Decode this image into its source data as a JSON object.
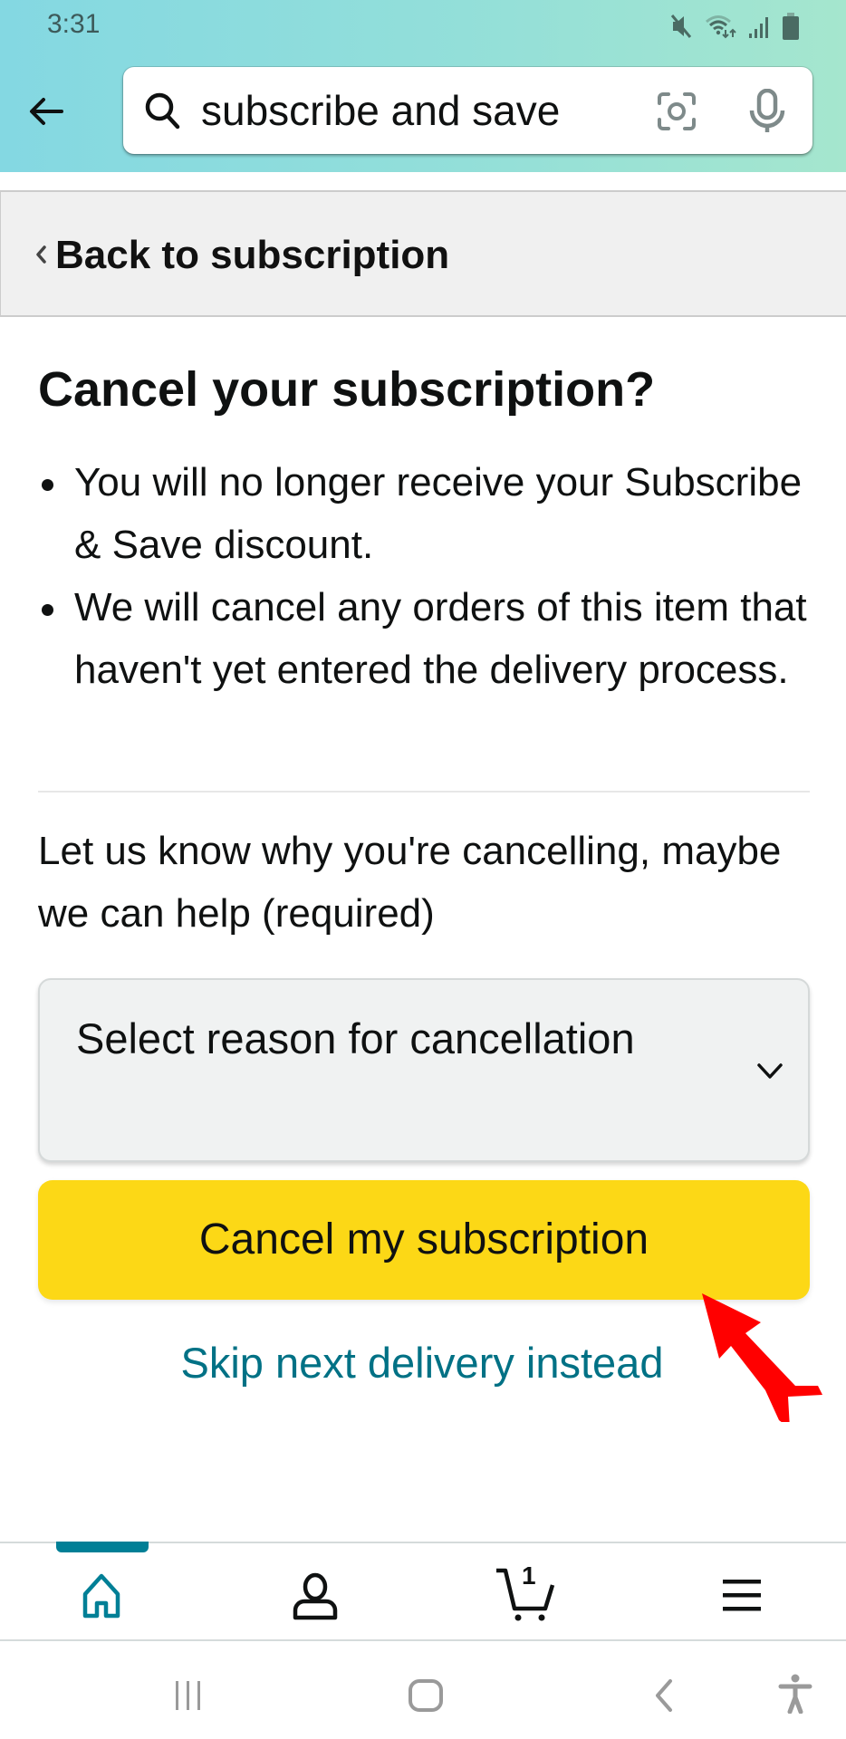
{
  "status_bar": {
    "time": "3:31",
    "icons": [
      "mute-icon",
      "wifi-icon",
      "signal-icon",
      "battery-icon"
    ]
  },
  "header": {
    "back_icon": "arrow-left-icon",
    "search": {
      "value": "subscribe and save",
      "icons": [
        "search-icon",
        "camera-lens-icon",
        "microphone-icon"
      ]
    },
    "colors": {
      "gradient_start": "#84D8E2",
      "gradient_end": "#A5E6CE"
    }
  },
  "back_bar": {
    "label": "Back to subscription",
    "icon": "chevron-left-icon"
  },
  "main": {
    "title": "Cancel your subscription?",
    "bullets": [
      "You will no longer receive your Subscribe & Save discount.",
      "We will cancel any orders of this item that haven't yet entered the delivery process."
    ],
    "reason_prompt": "Let us know why you're cancelling, maybe we can help (required)",
    "reason_select": {
      "selected": "Select reason for cancellation",
      "icon": "chevron-down-icon"
    },
    "cancel_button": {
      "label": "Cancel my subscription",
      "color": "#FCD816"
    },
    "skip_link": {
      "label": "Skip next delivery instead",
      "color": "#007185"
    }
  },
  "annotation": {
    "type": "red-arrow",
    "color": "#FF0000",
    "points_to": "cancel-button"
  },
  "bottom_nav": {
    "active": "home",
    "accent": "#007F96",
    "items": [
      {
        "id": "home",
        "icon": "home-icon"
      },
      {
        "id": "account",
        "icon": "user-icon"
      },
      {
        "id": "cart",
        "icon": "cart-icon",
        "count": "1"
      },
      {
        "id": "menu",
        "icon": "hamburger-menu-icon"
      }
    ]
  },
  "system_nav": {
    "items": [
      "recent-apps-icon",
      "home-button-icon",
      "back-icon",
      "accessibility-icon"
    ]
  }
}
